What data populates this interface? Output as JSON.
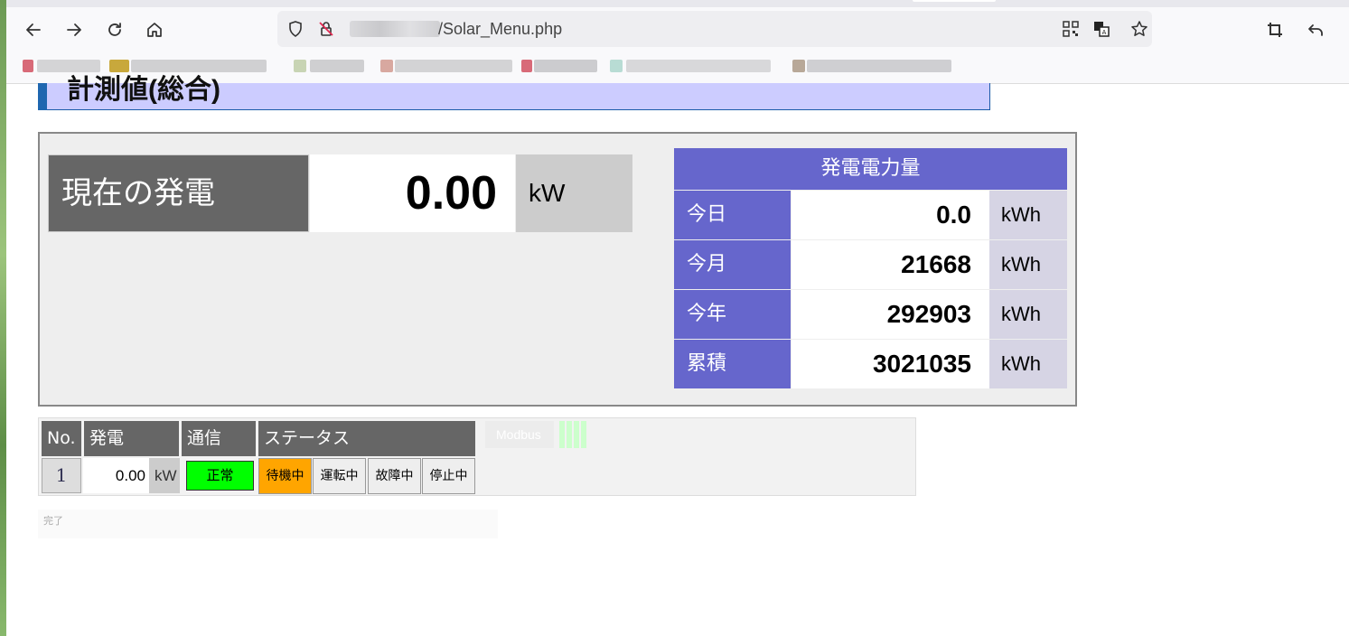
{
  "browser": {
    "url_suffix": "/Solar_Menu.php",
    "icons": [
      "back-icon",
      "forward-icon",
      "reload-icon",
      "home-icon",
      "shield-icon",
      "insecure-lock-icon",
      "qr-code-icon",
      "translate-icon",
      "star-icon",
      "crop-icon",
      "undo-icon"
    ]
  },
  "page": {
    "title": "計測値(総合)"
  },
  "current_power": {
    "label": "現在の発電",
    "value": "0.00",
    "unit": "kW"
  },
  "energy": {
    "header": "発電電力量",
    "rows": [
      {
        "label": "今日",
        "value": "0.0",
        "unit": "kWh"
      },
      {
        "label": "今月",
        "value": "21668",
        "unit": "kWh"
      },
      {
        "label": "今年",
        "value": "292903",
        "unit": "kWh"
      },
      {
        "label": "累積",
        "value": "3021035",
        "unit": "kWh"
      }
    ]
  },
  "inverter_table": {
    "headers": [
      "No.",
      "発電",
      "通信",
      "ステータス"
    ],
    "row": {
      "no": "1",
      "power": "0.00",
      "power_unit": "kW",
      "comm": "正常",
      "status_buttons": [
        "待機中",
        "運転中",
        "故障中",
        "停止中"
      ],
      "active_status": "待機中"
    },
    "modbus_label": "Modbus"
  },
  "status_text": "完了",
  "colors": {
    "title_bg": "#ccccff",
    "label_purple": "#6666cc",
    "comm_ok": "#00ff00",
    "status_active": "#ffa500"
  }
}
